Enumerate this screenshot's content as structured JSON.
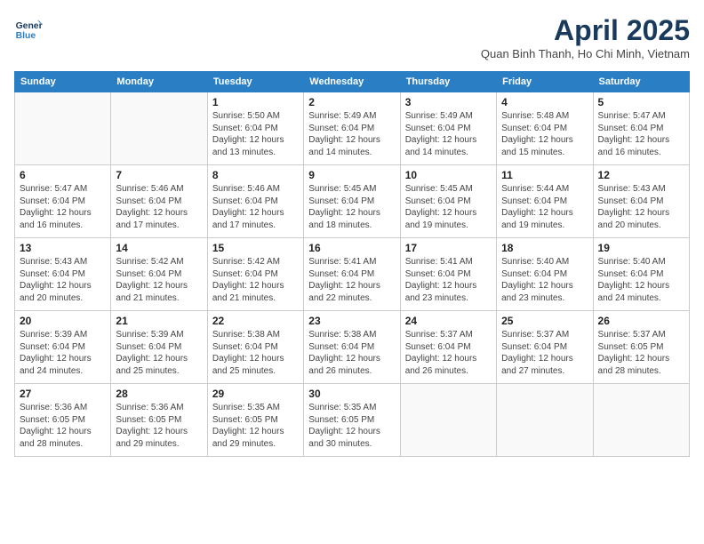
{
  "header": {
    "logo_line1": "General",
    "logo_line2": "Blue",
    "month_title": "April 2025",
    "location": "Quan Binh Thanh, Ho Chi Minh, Vietnam"
  },
  "days_of_week": [
    "Sunday",
    "Monday",
    "Tuesday",
    "Wednesday",
    "Thursday",
    "Friday",
    "Saturday"
  ],
  "weeks": [
    [
      {
        "day": "",
        "lines": []
      },
      {
        "day": "",
        "lines": []
      },
      {
        "day": "1",
        "lines": [
          "Sunrise: 5:50 AM",
          "Sunset: 6:04 PM",
          "Daylight: 12 hours",
          "and 13 minutes."
        ]
      },
      {
        "day": "2",
        "lines": [
          "Sunrise: 5:49 AM",
          "Sunset: 6:04 PM",
          "Daylight: 12 hours",
          "and 14 minutes."
        ]
      },
      {
        "day": "3",
        "lines": [
          "Sunrise: 5:49 AM",
          "Sunset: 6:04 PM",
          "Daylight: 12 hours",
          "and 14 minutes."
        ]
      },
      {
        "day": "4",
        "lines": [
          "Sunrise: 5:48 AM",
          "Sunset: 6:04 PM",
          "Daylight: 12 hours",
          "and 15 minutes."
        ]
      },
      {
        "day": "5",
        "lines": [
          "Sunrise: 5:47 AM",
          "Sunset: 6:04 PM",
          "Daylight: 12 hours",
          "and 16 minutes."
        ]
      }
    ],
    [
      {
        "day": "6",
        "lines": [
          "Sunrise: 5:47 AM",
          "Sunset: 6:04 PM",
          "Daylight: 12 hours",
          "and 16 minutes."
        ]
      },
      {
        "day": "7",
        "lines": [
          "Sunrise: 5:46 AM",
          "Sunset: 6:04 PM",
          "Daylight: 12 hours",
          "and 17 minutes."
        ]
      },
      {
        "day": "8",
        "lines": [
          "Sunrise: 5:46 AM",
          "Sunset: 6:04 PM",
          "Daylight: 12 hours",
          "and 17 minutes."
        ]
      },
      {
        "day": "9",
        "lines": [
          "Sunrise: 5:45 AM",
          "Sunset: 6:04 PM",
          "Daylight: 12 hours",
          "and 18 minutes."
        ]
      },
      {
        "day": "10",
        "lines": [
          "Sunrise: 5:45 AM",
          "Sunset: 6:04 PM",
          "Daylight: 12 hours",
          "and 19 minutes."
        ]
      },
      {
        "day": "11",
        "lines": [
          "Sunrise: 5:44 AM",
          "Sunset: 6:04 PM",
          "Daylight: 12 hours",
          "and 19 minutes."
        ]
      },
      {
        "day": "12",
        "lines": [
          "Sunrise: 5:43 AM",
          "Sunset: 6:04 PM",
          "Daylight: 12 hours",
          "and 20 minutes."
        ]
      }
    ],
    [
      {
        "day": "13",
        "lines": [
          "Sunrise: 5:43 AM",
          "Sunset: 6:04 PM",
          "Daylight: 12 hours",
          "and 20 minutes."
        ]
      },
      {
        "day": "14",
        "lines": [
          "Sunrise: 5:42 AM",
          "Sunset: 6:04 PM",
          "Daylight: 12 hours",
          "and 21 minutes."
        ]
      },
      {
        "day": "15",
        "lines": [
          "Sunrise: 5:42 AM",
          "Sunset: 6:04 PM",
          "Daylight: 12 hours",
          "and 21 minutes."
        ]
      },
      {
        "day": "16",
        "lines": [
          "Sunrise: 5:41 AM",
          "Sunset: 6:04 PM",
          "Daylight: 12 hours",
          "and 22 minutes."
        ]
      },
      {
        "day": "17",
        "lines": [
          "Sunrise: 5:41 AM",
          "Sunset: 6:04 PM",
          "Daylight: 12 hours",
          "and 23 minutes."
        ]
      },
      {
        "day": "18",
        "lines": [
          "Sunrise: 5:40 AM",
          "Sunset: 6:04 PM",
          "Daylight: 12 hours",
          "and 23 minutes."
        ]
      },
      {
        "day": "19",
        "lines": [
          "Sunrise: 5:40 AM",
          "Sunset: 6:04 PM",
          "Daylight: 12 hours",
          "and 24 minutes."
        ]
      }
    ],
    [
      {
        "day": "20",
        "lines": [
          "Sunrise: 5:39 AM",
          "Sunset: 6:04 PM",
          "Daylight: 12 hours",
          "and 24 minutes."
        ]
      },
      {
        "day": "21",
        "lines": [
          "Sunrise: 5:39 AM",
          "Sunset: 6:04 PM",
          "Daylight: 12 hours",
          "and 25 minutes."
        ]
      },
      {
        "day": "22",
        "lines": [
          "Sunrise: 5:38 AM",
          "Sunset: 6:04 PM",
          "Daylight: 12 hours",
          "and 25 minutes."
        ]
      },
      {
        "day": "23",
        "lines": [
          "Sunrise: 5:38 AM",
          "Sunset: 6:04 PM",
          "Daylight: 12 hours",
          "and 26 minutes."
        ]
      },
      {
        "day": "24",
        "lines": [
          "Sunrise: 5:37 AM",
          "Sunset: 6:04 PM",
          "Daylight: 12 hours",
          "and 26 minutes."
        ]
      },
      {
        "day": "25",
        "lines": [
          "Sunrise: 5:37 AM",
          "Sunset: 6:04 PM",
          "Daylight: 12 hours",
          "and 27 minutes."
        ]
      },
      {
        "day": "26",
        "lines": [
          "Sunrise: 5:37 AM",
          "Sunset: 6:05 PM",
          "Daylight: 12 hours",
          "and 28 minutes."
        ]
      }
    ],
    [
      {
        "day": "27",
        "lines": [
          "Sunrise: 5:36 AM",
          "Sunset: 6:05 PM",
          "Daylight: 12 hours",
          "and 28 minutes."
        ]
      },
      {
        "day": "28",
        "lines": [
          "Sunrise: 5:36 AM",
          "Sunset: 6:05 PM",
          "Daylight: 12 hours",
          "and 29 minutes."
        ]
      },
      {
        "day": "29",
        "lines": [
          "Sunrise: 5:35 AM",
          "Sunset: 6:05 PM",
          "Daylight: 12 hours",
          "and 29 minutes."
        ]
      },
      {
        "day": "30",
        "lines": [
          "Sunrise: 5:35 AM",
          "Sunset: 6:05 PM",
          "Daylight: 12 hours",
          "and 30 minutes."
        ]
      },
      {
        "day": "",
        "lines": []
      },
      {
        "day": "",
        "lines": []
      },
      {
        "day": "",
        "lines": []
      }
    ]
  ]
}
